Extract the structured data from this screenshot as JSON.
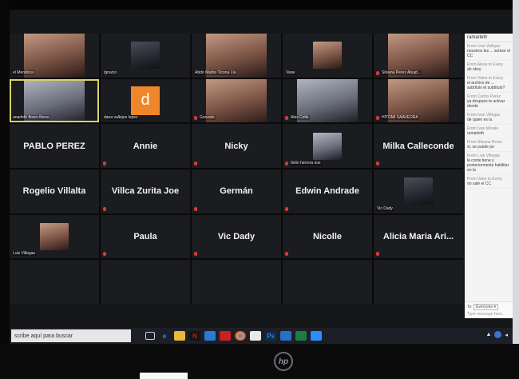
{
  "taskbar": {
    "search_placeholder": "scribe aquí para buscar",
    "apps": [
      "task-view",
      "edge",
      "files",
      "netflix",
      "store",
      "acrobat",
      "chrome",
      "app-a",
      "photoshop",
      "app-b",
      "app-c",
      "zoom"
    ]
  },
  "participants": [
    {
      "name": "el Mendoza",
      "type": "video",
      "tone": "face",
      "muted": false
    },
    {
      "name": "Ignacio",
      "type": "video",
      "tone": "dark",
      "muted": false
    },
    {
      "name": "Abdo Marbo Ticona Lla",
      "type": "video",
      "tone": "face",
      "muted": false
    },
    {
      "name": "Vane",
      "type": "video",
      "tone": "face",
      "muted": false
    },
    {
      "name": "Silvana Perez Abujd...",
      "type": "video",
      "tone": "face",
      "muted": true
    },
    {
      "name": "anarleth flores flores",
      "type": "video",
      "tone": "cool",
      "muted": false,
      "active": true
    },
    {
      "name": "dana vallejos lopez",
      "type": "avatar",
      "initial": "d",
      "muted": false
    },
    {
      "name": "Gonzalo",
      "type": "video",
      "tone": "face",
      "muted": true
    },
    {
      "name": "Alex Celle",
      "type": "video",
      "tone": "cool",
      "muted": true
    },
    {
      "name": "HITOMI SAAVEDRA",
      "type": "video",
      "tone": "face",
      "muted": true
    },
    {
      "name": "PABLO PEREZ",
      "type": "text",
      "muted": false
    },
    {
      "name": "Annie",
      "type": "text",
      "muted": true
    },
    {
      "name": "Nicky",
      "type": "text",
      "muted": true
    },
    {
      "name": "Itelin herrera rios",
      "type": "video",
      "tone": "cool",
      "muted": true
    },
    {
      "name": "Milka Calleconde",
      "type": "text",
      "muted": true
    },
    {
      "name": "Rogelio Villalta",
      "type": "text",
      "muted": false
    },
    {
      "name": "Villca Zurita Joe",
      "type": "text",
      "muted": true
    },
    {
      "name": "Germán",
      "type": "text",
      "muted": true
    },
    {
      "name": "Edwin Andrade",
      "type": "text",
      "muted": true
    },
    {
      "name": "Vic Dady",
      "type": "video",
      "tone": "dark",
      "muted": false
    },
    {
      "name": "Luis Villegas",
      "type": "video",
      "tone": "face",
      "muted": false
    },
    {
      "name": "Paula",
      "type": "text",
      "muted": true
    },
    {
      "name": "Vic Dady",
      "type": "text",
      "muted": true
    },
    {
      "name": "Nicolle",
      "type": "text",
      "muted": true
    },
    {
      "name": "Alicia Maria Ari...",
      "type": "text",
      "muted": true
    }
  ],
  "chat": {
    "to_label": "ramarleth",
    "messages": [
      {
        "from": "From Ivan Vallejos",
        "text": "nosotros los ... activar el CC"
      },
      {
        "from": "From Alexa to Every",
        "text": "ah okey"
      },
      {
        "from": "From Valne to Every",
        "text": "el archivo de ... subtítulo el subtítulo?"
      },
      {
        "from": "From Carlos Perez",
        "text": "ya después te activar donde"
      },
      {
        "from": "From Ivan Villegas",
        "text": "de quien es la"
      },
      {
        "from": "From Ivan Morale",
        "text": "ramarleth"
      },
      {
        "from": "From Silvana Perez",
        "text": "si, se puede pe"
      },
      {
        "from": "From Luis Villegas",
        "text": "la conte tiene y posteriormente habilitar en la"
      },
      {
        "from": "From Vane to Every",
        "text": "no sale el CC"
      }
    ],
    "footer_to": "To:",
    "footer_select": "Everyone ▾",
    "input_placeholder": "Type message here..."
  },
  "brand": "hp"
}
